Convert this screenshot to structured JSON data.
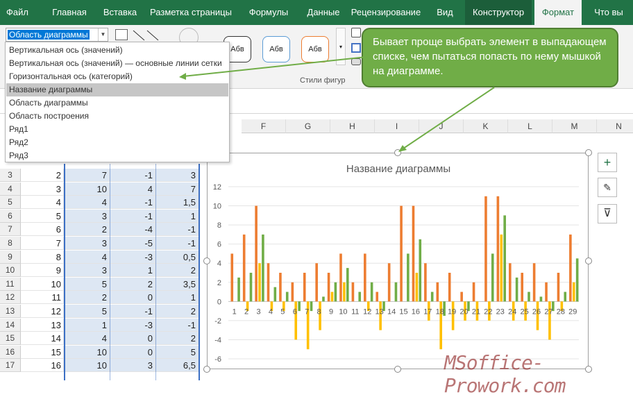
{
  "tabs": [
    "Файл",
    "Главная",
    "Вставка",
    "Разметка страницы",
    "Формулы",
    "Данные",
    "Рецензирование",
    "Вид",
    "Конструктор",
    "Формат",
    "Что вы"
  ],
  "ribbon": {
    "element_selector": "Область диаграммы",
    "shape_style_sample": "Абв",
    "group_label": "Стили фигур"
  },
  "dropdown_items": [
    "Вертикальная ось (значений)",
    "Вертикальная ось (значений)   — основные линии сетки",
    "Горизонтальная ось (категорий)",
    "Название диаграммы",
    "Область диаграммы",
    "Область построения",
    "Ряд1",
    "Ряд2",
    "Ряд3"
  ],
  "dropdown_selected": "Название диаграммы",
  "callout": "Бывает проще выбрать элемент в выпадающем списке, чем пытаться попасть по нему мышкой на диаграмме.",
  "columns": [
    "F",
    "G",
    "H",
    "I",
    "J",
    "K",
    "L",
    "M",
    "N"
  ],
  "rows": [
    {
      "n": "3",
      "a": "2",
      "b": "7",
      "c": "-1",
      "d": "3"
    },
    {
      "n": "4",
      "a": "3",
      "b": "10",
      "c": "4",
      "d": "7"
    },
    {
      "n": "5",
      "a": "4",
      "b": "4",
      "c": "-1",
      "d": "1,5"
    },
    {
      "n": "6",
      "a": "5",
      "b": "3",
      "c": "-1",
      "d": "1"
    },
    {
      "n": "7",
      "a": "6",
      "b": "2",
      "c": "-4",
      "d": "-1"
    },
    {
      "n": "8",
      "a": "7",
      "b": "3",
      "c": "-5",
      "d": "-1"
    },
    {
      "n": "9",
      "a": "8",
      "b": "4",
      "c": "-3",
      "d": "0,5"
    },
    {
      "n": "10",
      "a": "9",
      "b": "3",
      "c": "1",
      "d": "2"
    },
    {
      "n": "11",
      "a": "10",
      "b": "5",
      "c": "2",
      "d": "3,5"
    },
    {
      "n": "12",
      "a": "11",
      "b": "2",
      "c": "0",
      "d": "1"
    },
    {
      "n": "13",
      "a": "12",
      "b": "5",
      "c": "-1",
      "d": "2"
    },
    {
      "n": "14",
      "a": "13",
      "b": "1",
      "c": "-3",
      "d": "-1"
    },
    {
      "n": "15",
      "a": "14",
      "b": "4",
      "c": "0",
      "d": "2"
    },
    {
      "n": "16",
      "a": "15",
      "b": "10",
      "c": "0",
      "d": "5"
    },
    {
      "n": "17",
      "a": "16",
      "b": "10",
      "c": "3",
      "d": "6,5"
    }
  ],
  "side_buttons": [
    "+",
    "✎",
    "⊽"
  ],
  "watermark": "MSoffice-Prowork.com",
  "chart_data": {
    "type": "bar",
    "title": "Название диаграммы",
    "categories": [
      "1",
      "2",
      "3",
      "4",
      "5",
      "6",
      "7",
      "8",
      "9",
      "10",
      "11",
      "12",
      "13",
      "14",
      "15",
      "16",
      "17",
      "18",
      "19",
      "20",
      "21",
      "22",
      "23",
      "24",
      "25",
      "26",
      "27",
      "28",
      "29"
    ],
    "ylim": [
      -6,
      12
    ],
    "yticks": [
      -6,
      -4,
      -2,
      0,
      2,
      4,
      6,
      8,
      10,
      12
    ],
    "series": [
      {
        "values": [
          5,
          7,
          10,
          4,
          3,
          2,
          3,
          4,
          3,
          5,
          2,
          5,
          1,
          4,
          10,
          10,
          4,
          2,
          3,
          1,
          2,
          11,
          11,
          4,
          3,
          4,
          2,
          3,
          7
        ],
        "color": "#ed7d31"
      },
      {
        "values": [
          0,
          -1,
          4,
          -1,
          -1,
          -4,
          -5,
          -3,
          1,
          2,
          0,
          -1,
          -3,
          0,
          0,
          3,
          -2,
          -5,
          -3,
          -2,
          -2,
          -2,
          7,
          -2,
          -2,
          -3,
          -4,
          -1,
          2
        ],
        "color": "#ffc000"
      },
      {
        "values": [
          2.5,
          3,
          7,
          1.5,
          1,
          -1,
          -1,
          0.5,
          2,
          3.5,
          1,
          2,
          -1,
          2,
          5,
          6.5,
          1,
          -1.5,
          0,
          -1,
          0,
          5,
          9,
          2.5,
          1,
          0.5,
          -1,
          1,
          4.5
        ],
        "color": "#70ad47"
      }
    ]
  }
}
